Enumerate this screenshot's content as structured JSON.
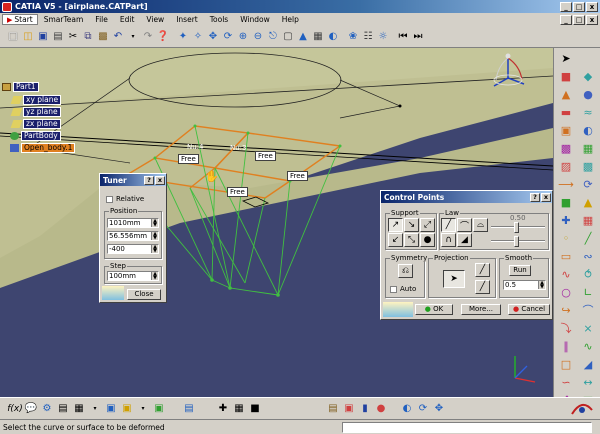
{
  "window": {
    "title": "CATIA V5 - [airplane.CATPart]",
    "minimize": "_",
    "restore": "□",
    "close": "x"
  },
  "menubar": {
    "items": [
      "Start",
      "SmarTeam",
      "File",
      "Edit",
      "View",
      "Insert",
      "Tools",
      "Window",
      "Help"
    ]
  },
  "spec_tree": {
    "root": "Part1",
    "items": [
      "xy plane",
      "yz plane",
      "zx plane",
      "PartBody",
      "Open_body.1"
    ]
  },
  "viewport_labels": {
    "nu4": "Nu:4",
    "nu3": "Nu:3",
    "free1": "Free",
    "free2": "Free",
    "free3": "Free",
    "free4": "Free"
  },
  "tuner": {
    "title": "Tuner",
    "relative_label": "Relative",
    "position_label": "Position",
    "x_value": "1010mm",
    "y_value": "56.556mm",
    "z_value": "-400",
    "step_label": "Step",
    "step_value": "100mm",
    "close_label": "Close"
  },
  "control_points": {
    "title": "Control Points",
    "support_label": "Support",
    "law_label": "Law",
    "law_value": "0.50",
    "symmetry_label": "Symmetry",
    "auto_label": "Auto",
    "projection_label": "Projection",
    "smooth_label": "Smooth",
    "run_label": "Run",
    "smooth_value": "0.5",
    "ok_label": "OK",
    "more_label": "More...",
    "cancel_label": "Cancel"
  },
  "status": {
    "message": "Select the curve or surface to be deformed"
  },
  "colors": {
    "background": "#3e4570",
    "surface": "#c8c89a",
    "control_net": "#e08020",
    "mesh": "#40c040"
  }
}
